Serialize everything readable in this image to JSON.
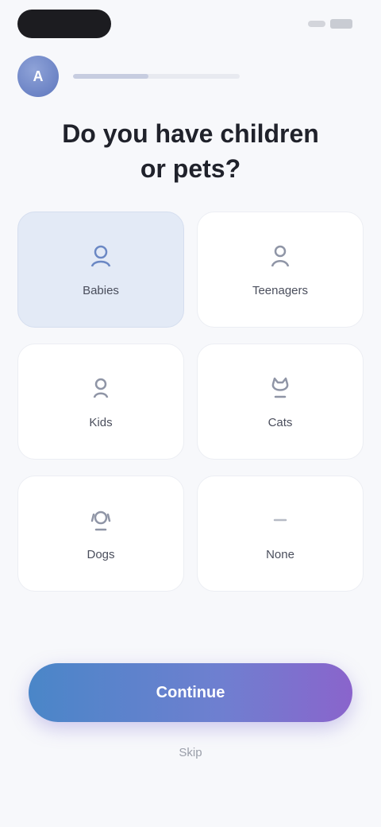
{
  "header": {
    "avatar_initials": "A",
    "progress_fraction": 0.45
  },
  "title": "Do you have children or pets?",
  "options": [
    {
      "label": "Babies",
      "icon": "baby-icon",
      "selected": true
    },
    {
      "label": "Teenagers",
      "icon": "teen-icon",
      "selected": false
    },
    {
      "label": "Kids",
      "icon": "child-icon",
      "selected": false
    },
    {
      "label": "Cats",
      "icon": "cat-icon",
      "selected": false
    },
    {
      "label": "Dogs",
      "icon": "dog-icon",
      "selected": false
    },
    {
      "label": "None",
      "icon": "none-icon",
      "selected": false
    }
  ],
  "actions": {
    "continue_label": "Continue",
    "skip_label": "Skip"
  },
  "colors": {
    "accent_start": "#4a86c8",
    "accent_end": "#8a64cc",
    "selected_card": "#e3eaf6"
  }
}
